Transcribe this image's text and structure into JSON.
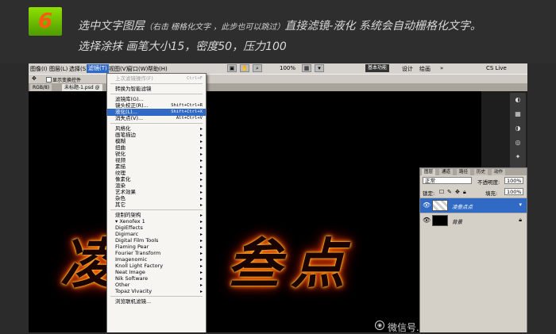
{
  "step": {
    "number": "6"
  },
  "instruction": {
    "line1_a": "选中文字图层",
    "line1_note": "（右击 栅格化文字 ，此步也可以跳过）",
    "line1_b": "直接滤镜-液化  系统会自动栅格化文字。",
    "line2": "选择涂抹 画笔大小15，密度50，压力100"
  },
  "photoshop": {
    "menubar": {
      "items": [
        "图像(I)",
        "图层(L)",
        "选择(S)",
        "滤镜(T)",
        "视图(V)",
        "窗口(W)",
        "帮助(H)"
      ],
      "active_index": 3,
      "zoom": "100%",
      "workspace_buttons": [
        "基本功能",
        "设计",
        "绘画"
      ],
      "extra": "CS Live"
    },
    "options": {
      "checkbox_label": "显示变换控件"
    },
    "tabs": [
      "RGB/8)",
      "未标题-1.psd @"
    ],
    "canvas": {
      "text_glyphs": [
        "凌",
        "叁",
        "点"
      ]
    },
    "filter_menu": {
      "items": [
        {
          "label": "上次滤镜操作(F)",
          "shortcut": "Ctrl+F",
          "disabled": true
        },
        {
          "sep": true
        },
        {
          "label": "转换为智能滤镜"
        },
        {
          "sep": true
        },
        {
          "label": "滤镜库(G)..."
        },
        {
          "label": "镜头校正(R)...",
          "shortcut": "Shift+Ctrl+R"
        },
        {
          "label": "液化(L)...",
          "shortcut": "Shift+Ctrl+X",
          "highlight": true
        },
        {
          "label": "消失点(V)...",
          "shortcut": "Alt+Ctrl+V"
        },
        {
          "sep": true
        },
        {
          "label": "风格化",
          "submenu": true
        },
        {
          "label": "画笔描边",
          "submenu": true
        },
        {
          "label": "模糊",
          "submenu": true
        },
        {
          "label": "扭曲",
          "submenu": true
        },
        {
          "label": "锐化",
          "submenu": true
        },
        {
          "label": "视频",
          "submenu": true
        },
        {
          "label": "素描",
          "submenu": true
        },
        {
          "label": "纹理",
          "submenu": true
        },
        {
          "label": "像素化",
          "submenu": true
        },
        {
          "label": "渲染",
          "submenu": true
        },
        {
          "label": "艺术效果",
          "submenu": true
        },
        {
          "label": "杂色",
          "submenu": true
        },
        {
          "label": "其它",
          "submenu": true
        },
        {
          "sep": true
        },
        {
          "label": "烧制的架构",
          "submenu": true
        },
        {
          "label": "▾ Xenofex 1",
          "submenu": true
        },
        {
          "label": "DigiEffects",
          "submenu": true
        },
        {
          "label": "Digimarc",
          "submenu": true
        },
        {
          "label": "Digital Film Tools",
          "submenu": true
        },
        {
          "label": "Flaming Pear",
          "submenu": true
        },
        {
          "label": "Fourier Transform",
          "submenu": true
        },
        {
          "label": "Imagenomic",
          "submenu": true
        },
        {
          "label": "Knoll Light Factory",
          "submenu": true
        },
        {
          "label": "Neat Image",
          "submenu": true
        },
        {
          "label": "Nik Software",
          "submenu": true
        },
        {
          "label": "Other",
          "submenu": true
        },
        {
          "label": "Topaz Vivacity",
          "submenu": true
        },
        {
          "sep": true
        },
        {
          "label": "浏览联机滤镜..."
        }
      ]
    },
    "layers_panel": {
      "tabs": [
        "图层",
        "通道",
        "路径",
        "历史",
        "动作"
      ],
      "blend_mode": "正常",
      "opacity_label": "不透明度:",
      "opacity": "100%",
      "lock_label": "锁定:",
      "fill_label": "填充:",
      "fill": "100%",
      "layers": [
        {
          "name": "凌叁点点",
          "selected": true,
          "thumb": "transparent"
        },
        {
          "name": "背景",
          "selected": false,
          "thumb": "black",
          "locked": true
        }
      ]
    }
  },
  "watermark": {
    "text": "微信号..."
  }
}
